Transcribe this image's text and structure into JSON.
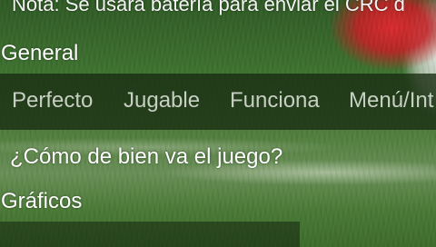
{
  "notice": "Nota: Se usará batería para enviar el CRC d",
  "sections": {
    "general": "General",
    "graphics": "Gráficos"
  },
  "choices": [
    "Perfecto",
    "Jugable",
    "Funciona",
    "Menú/Int"
  ],
  "question": "¿Cómo de bien va el juego?",
  "colors": {
    "text": "#ffffff",
    "choice_text": "#c6cfc2",
    "choice_bar": "#182c12"
  }
}
